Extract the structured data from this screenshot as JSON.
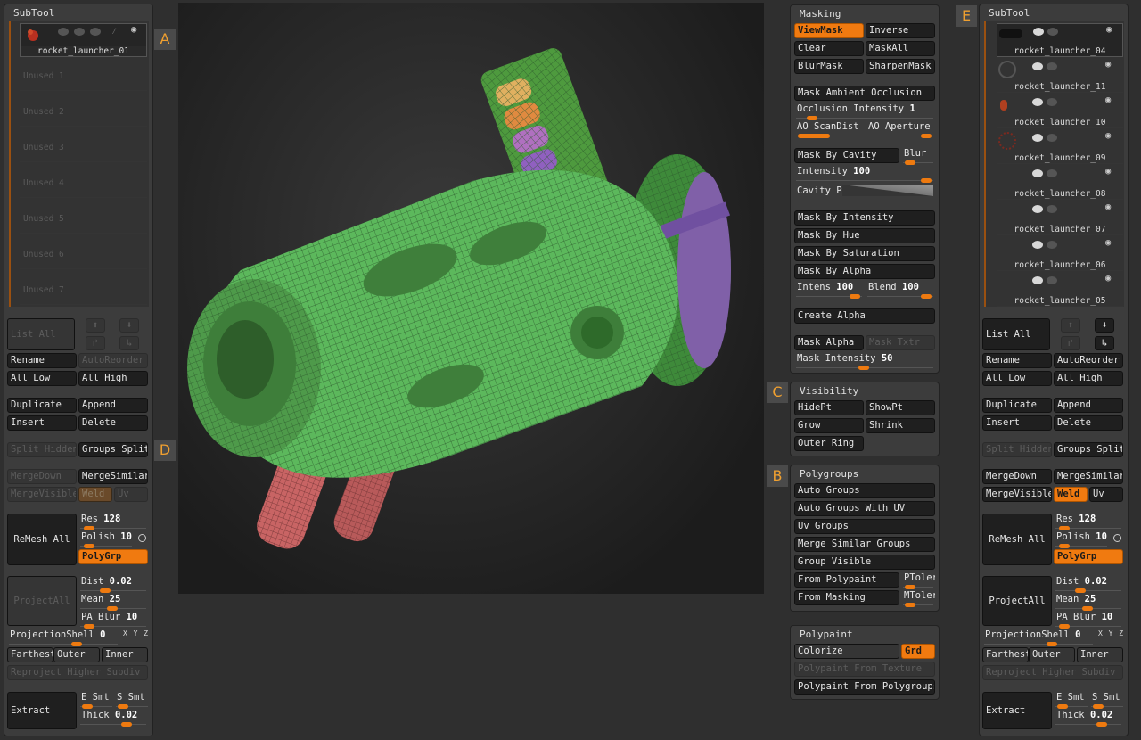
{
  "markers": {
    "a": "A",
    "b": "B",
    "c": "C",
    "d": "D",
    "e": "E"
  },
  "left": {
    "title": "SubTool",
    "active_name": "rocket_launcher_01",
    "unused": [
      "Unused 1",
      "Unused 2",
      "Unused 3",
      "Unused 4",
      "Unused 5",
      "Unused 6",
      "Unused 7"
    ],
    "list_all": "List All",
    "rename": "Rename",
    "autoreorder": "AutoReorder",
    "all_low": "All Low",
    "all_high": "All High",
    "duplicate": "Duplicate",
    "append": "Append",
    "insert": "Insert",
    "delete": "Delete",
    "split_hidden": "Split Hidden",
    "groups_split": "Groups Split",
    "mergedown": "MergeDown",
    "mergesimilar": "MergeSimilar",
    "mergevisible": "MergeVisible",
    "weld": "Weld",
    "uv": "Uv",
    "remesh_all": "ReMesh All",
    "res_label": "Res",
    "res_value": "128",
    "polish_label": "Polish",
    "polish_value": "10",
    "polygrp": "PolyGrp",
    "projectall": "ProjectAll",
    "dist_label": "Dist",
    "dist_value": "0.02",
    "mean_label": "Mean",
    "mean_value": "25",
    "pablur_label": "PA Blur",
    "pablur_value": "10",
    "projectionshell_label": "ProjectionShell",
    "projectionshell_value": "0",
    "xyz": "X Y Z",
    "farthest": "Farthest",
    "outer": "Outer",
    "inner": "Inner",
    "reproject": "Reproject Higher Subdiv",
    "extract": "Extract",
    "esmt": "E Smt",
    "ssmt": "S Smt",
    "thick_label": "Thick",
    "thick_value": "0.02"
  },
  "masking": {
    "title": "Masking",
    "viewmask": "ViewMask",
    "inverse": "Inverse",
    "clear": "Clear",
    "maskall": "MaskAll",
    "blurmask": "BlurMask",
    "sharpenmask": "SharpenMask",
    "mask_ao": "Mask Ambient Occlusion",
    "occ_label": "Occlusion Intensity",
    "occ_value": "1",
    "ao_scandist": "AO ScanDist",
    "ao_aperture": "AO Aperture",
    "mask_by_cavity": "Mask By Cavity",
    "blur": "Blur",
    "intensity_label": "Intensity",
    "intensity_value": "100",
    "cavity_profile": "Cavity Profile",
    "mask_by_intensity": "Mask By Intensity",
    "mask_by_hue": "Mask By Hue",
    "mask_by_saturation": "Mask By Saturation",
    "mask_by_alpha": "Mask By Alpha",
    "intens_label": "Intens",
    "intens_value": "100",
    "blend_label": "Blend",
    "blend_value": "100",
    "create_alpha": "Create Alpha",
    "mask_alpha": "Mask Alpha",
    "mask_txtr": "Mask Txtr",
    "mask_intensity_label": "Mask Intensity",
    "mask_intensity_value": "50"
  },
  "visibility": {
    "title": "Visibility",
    "hidept": "HidePt",
    "showpt": "ShowPt",
    "grow": "Grow",
    "shrink": "Shrink",
    "outer_ring": "Outer Ring"
  },
  "polygroups": {
    "title": "Polygroups",
    "auto_groups": "Auto Groups",
    "auto_groups_uv": "Auto Groups With UV",
    "uv_groups": "Uv Groups",
    "merge_similar": "Merge Similar Groups",
    "group_visible": "Group Visible",
    "from_polypaint": "From Polypaint",
    "ptoler": "PToler",
    "from_masking": "From Masking",
    "mtoler": "MToler"
  },
  "polypaint": {
    "title": "Polypaint",
    "colorize": "Colorize",
    "grd": "Grd",
    "from_texture": "Polypaint From Texture",
    "from_polygroups": "Polypaint From Polygroups"
  },
  "right": {
    "title": "SubTool",
    "items": [
      "rocket_launcher_04",
      "rocket_launcher_11",
      "rocket_launcher_10",
      "rocket_launcher_09",
      "rocket_launcher_08",
      "rocket_launcher_07",
      "rocket_launcher_06",
      "rocket_launcher_05"
    ],
    "list_all": "List All",
    "rename": "Rename",
    "autoreorder": "AutoReorder",
    "all_low": "All Low",
    "all_high": "All High",
    "duplicate": "Duplicate",
    "append": "Append",
    "insert": "Insert",
    "delete": "Delete",
    "split_hidden": "Split Hidden",
    "groups_split": "Groups Split",
    "mergedown": "MergeDown",
    "mergesimilar": "MergeSimilar",
    "mergevisible": "MergeVisible",
    "weld": "Weld",
    "uv": "Uv",
    "remesh_all": "ReMesh All",
    "res_label": "Res",
    "res_value": "128",
    "polish_label": "Polish",
    "polish_value": "10",
    "polygrp": "PolyGrp",
    "projectall": "ProjectAll",
    "dist_label": "Dist",
    "dist_value": "0.02",
    "mean_label": "Mean",
    "mean_value": "25",
    "pablur_label": "PA Blur",
    "pablur_value": "10",
    "projectionshell_label": "ProjectionShell",
    "projectionshell_value": "0",
    "xyz": "X Y Z",
    "farthest": "Farthest",
    "outer": "Outer",
    "inner": "Inner",
    "reproject": "Reproject Higher Subdiv",
    "extract": "Extract",
    "esmt": "E Smt",
    "ssmt": "S Smt",
    "thick_label": "Thick",
    "thick_value": "0.02"
  },
  "colors": {
    "accent": "#f07a10",
    "panel": "#3c3c3c",
    "button": "#1f1f1f",
    "mesh": "#5cb85c"
  }
}
